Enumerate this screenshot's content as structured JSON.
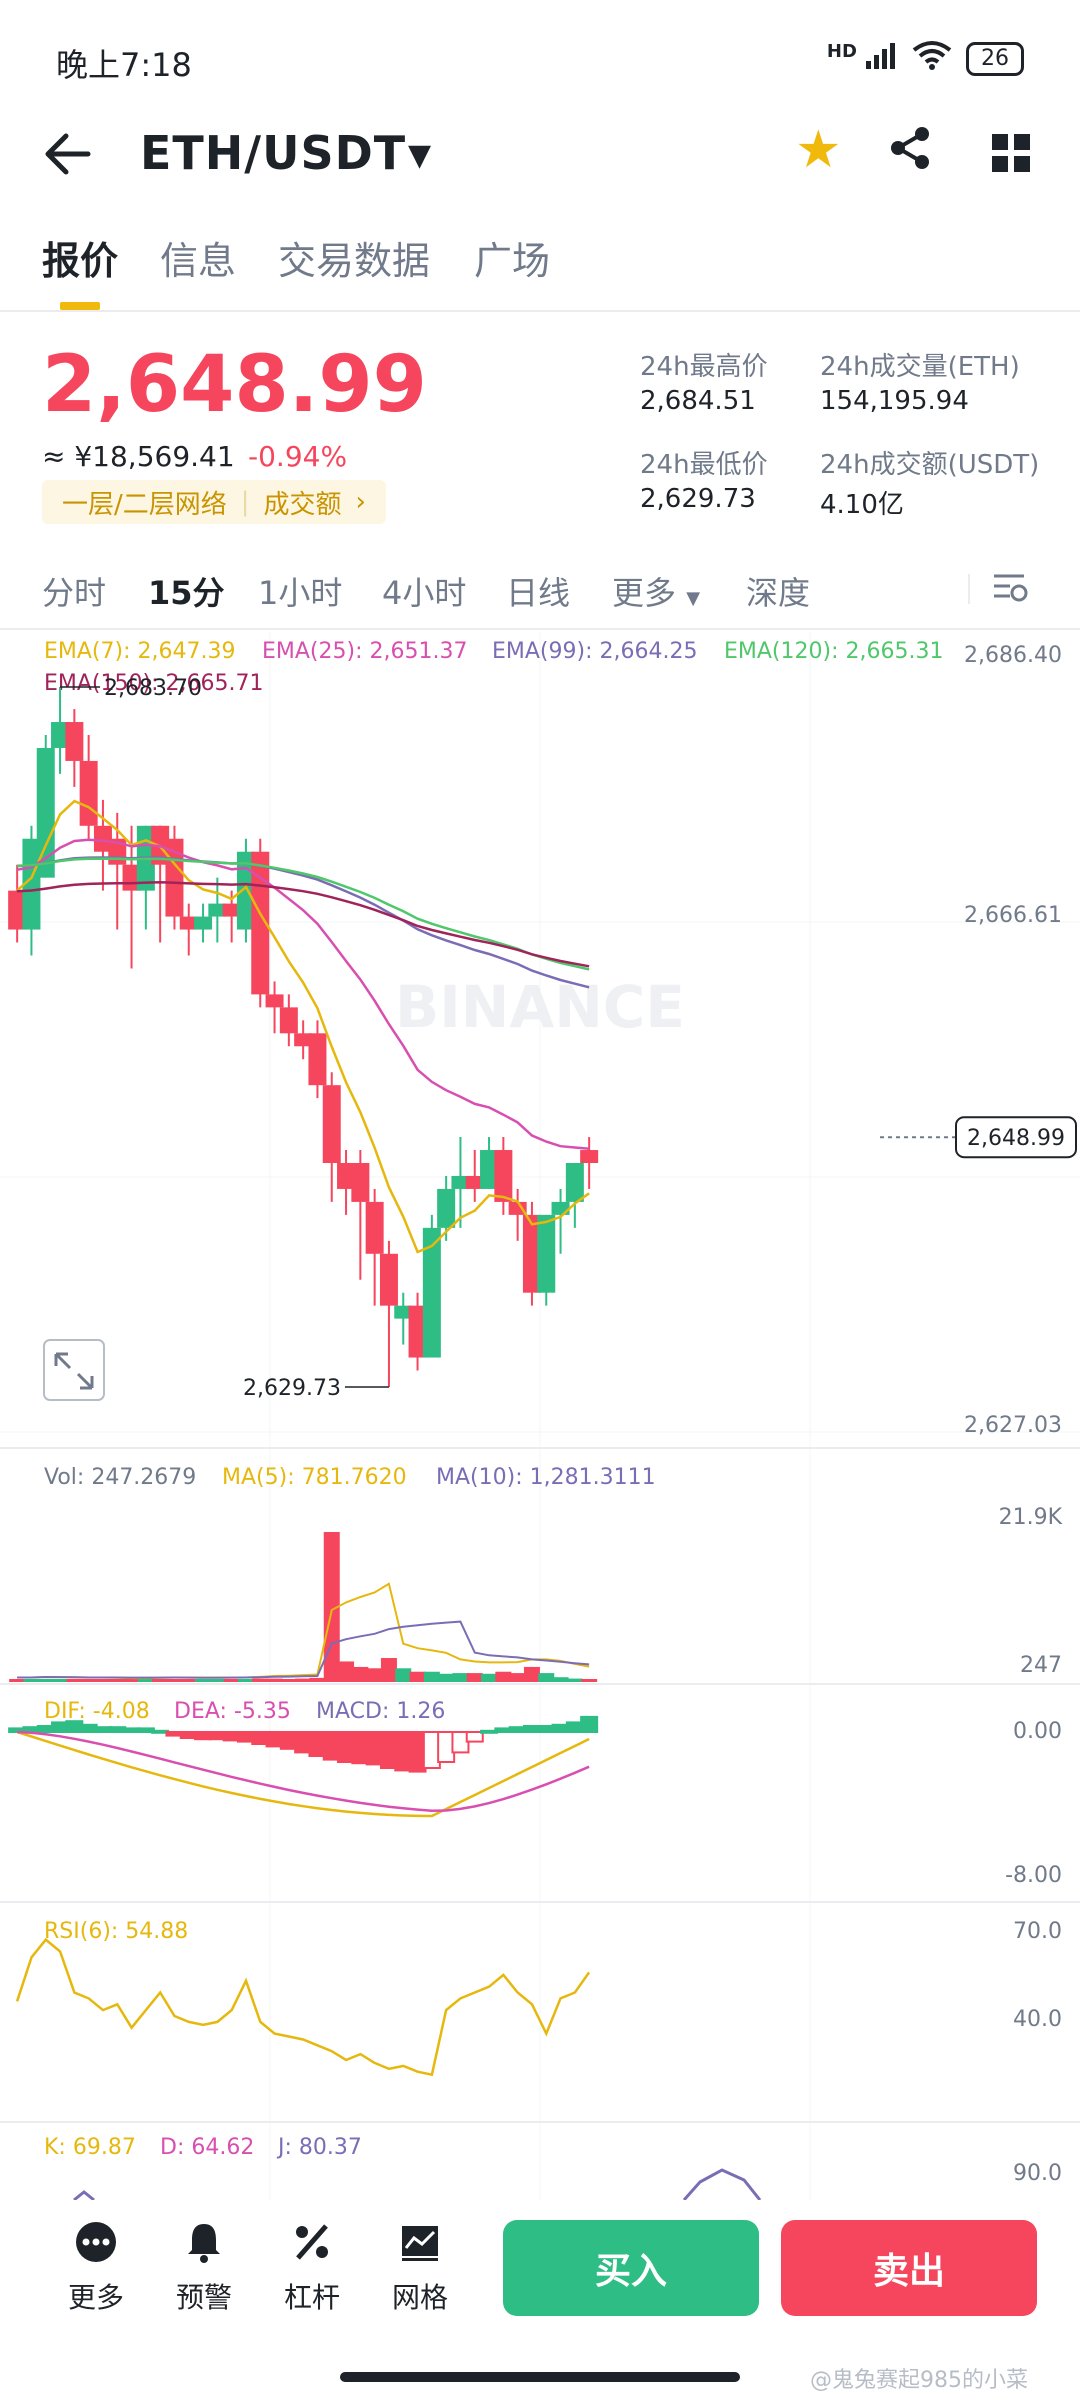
{
  "status_bar": {
    "time": "晚上7:18",
    "signal": "HD",
    "battery": "26"
  },
  "header": {
    "pair": "ETH/USDT"
  },
  "tabs": [
    "报价",
    "信息",
    "交易数据",
    "广场"
  ],
  "quote": {
    "last_price": "2,648.99",
    "cny_price": "≈ ¥18,569.41",
    "change": "-0.94%",
    "network_chip": "一层/二层网络",
    "volume_chip": "成交额",
    "stats": [
      {
        "label": "24h最高价",
        "value": "2,684.51"
      },
      {
        "label": "24h成交量(ETH)",
        "value": "154,195.94"
      },
      {
        "label": "24h最低价",
        "value": "2,629.73"
      },
      {
        "label": "24h成交额(USDT)",
        "value": "4.10亿"
      }
    ]
  },
  "kline_tabs": [
    "分时",
    "15分",
    "1小时",
    "4小时",
    "日线",
    "更多",
    "深度"
  ],
  "kline_active_index": 1,
  "ema_legend": {
    "ema7": "EMA(7): 2,647.39",
    "ema25": "EMA(25): 2,651.37",
    "ema99": "EMA(99): 2,664.25",
    "ema120": "EMA(120): 2,665.31",
    "ema150": "EMA(150): 2,665.71"
  },
  "price_axis": [
    "2,686.40",
    "2,666.61",
    "2,627.03"
  ],
  "current_price_tag": "2,648.99",
  "high_marker": "2,683.70",
  "low_marker": "2,629.73",
  "watermark_text": "BINANCE",
  "volume": {
    "vol": "Vol: 247.2679",
    "ma5": "MA(5): 781.7620",
    "ma10": "MA(10): 1,281.3111",
    "axis_top": "21.9K",
    "axis_bottom": "247"
  },
  "macd": {
    "dif": "DIF: -4.08",
    "dea": "DEA: -5.35",
    "macd": "MACD: 1.26",
    "axis_top": "0.00",
    "axis_bottom": "-8.00"
  },
  "rsi": {
    "label": "RSI(6): 54.88",
    "axis_top": "70.0",
    "axis_bottom": "40.0"
  },
  "kdj": {
    "k": "K: 69.87",
    "d": "D: 64.62",
    "j": "J: 80.37",
    "axis_top": "90.0"
  },
  "bottom_nav": [
    "更多",
    "预警",
    "杠杆",
    "网格"
  ],
  "buy_label": "买入",
  "sell_label": "卖出",
  "watermark_bottom": "@鬼兔赛起985的小菜",
  "colors": {
    "up": "#2ebd85",
    "down": "#f6465d",
    "brand": "#f0b90b",
    "ema7": "#e6b80e",
    "ema25": "#d84fb0",
    "ema99": "#7b6db5",
    "ema120": "#4fc76b",
    "ema150": "#a0235a"
  },
  "chart_data": {
    "type": "candlestick",
    "interval": "15分",
    "ylim": [
      2627.03,
      2686.4
    ],
    "high": 2683.7,
    "low": 2629.73,
    "last": 2648.99,
    "candles": [
      {
        "o": 2668,
        "h": 2670,
        "c": 2665,
        "l": 2664
      },
      {
        "o": 2665,
        "h": 2673,
        "c": 2672,
        "l": 2663
      },
      {
        "o": 2669,
        "h": 2680,
        "c": 2679,
        "l": 2669
      },
      {
        "o": 2679,
        "h": 2683.7,
        "c": 2681,
        "l": 2677
      },
      {
        "o": 2681,
        "h": 2682,
        "c": 2678,
        "l": 2676
      },
      {
        "o": 2678,
        "h": 2680,
        "c": 2673,
        "l": 2672
      },
      {
        "o": 2673,
        "h": 2675,
        "c": 2671,
        "l": 2668
      },
      {
        "o": 2672,
        "h": 2674,
        "c": 2670,
        "l": 2665
      },
      {
        "o": 2670,
        "h": 2673,
        "c": 2668,
        "l": 2662
      },
      {
        "o": 2668,
        "h": 2673,
        "c": 2673,
        "l": 2665
      },
      {
        "o": 2673,
        "h": 2673,
        "c": 2670,
        "l": 2664
      },
      {
        "o": 2672,
        "h": 2673,
        "c": 2666,
        "l": 2665
      },
      {
        "o": 2666,
        "h": 2667,
        "c": 2665,
        "l": 2663
      },
      {
        "o": 2665,
        "h": 2667,
        "c": 2666,
        "l": 2664
      },
      {
        "o": 2666,
        "h": 2669,
        "c": 2667,
        "l": 2664
      },
      {
        "o": 2667,
        "h": 2668,
        "c": 2666,
        "l": 2664
      },
      {
        "o": 2665,
        "h": 2672,
        "c": 2671,
        "l": 2664
      },
      {
        "o": 2671,
        "h": 2672,
        "c": 2660,
        "l": 2659
      },
      {
        "o": 2660,
        "h": 2661,
        "c": 2659,
        "l": 2657
      },
      {
        "o": 2659,
        "h": 2660,
        "c": 2657,
        "l": 2656
      },
      {
        "o": 2657,
        "h": 2658,
        "c": 2656,
        "l": 2655
      },
      {
        "o": 2657,
        "h": 2658,
        "c": 2653,
        "l": 2652
      },
      {
        "o": 2653,
        "h": 2654,
        "c": 2647,
        "l": 2644
      },
      {
        "o": 2647,
        "h": 2648,
        "c": 2645,
        "l": 2643
      },
      {
        "o": 2647,
        "h": 2648,
        "c": 2644,
        "l": 2638
      },
      {
        "o": 2644,
        "h": 2645,
        "c": 2640,
        "l": 2636
      },
      {
        "o": 2640,
        "h": 2641,
        "c": 2636,
        "l": 2629.73
      },
      {
        "o": 2635,
        "h": 2637,
        "c": 2636,
        "l": 2633
      },
      {
        "o": 2636,
        "h": 2637,
        "c": 2632,
        "l": 2631
      },
      {
        "o": 2632,
        "h": 2643,
        "c": 2642,
        "l": 2632
      },
      {
        "o": 2642,
        "h": 2646,
        "c": 2645,
        "l": 2641
      },
      {
        "o": 2645,
        "h": 2649,
        "c": 2646,
        "l": 2642
      },
      {
        "o": 2646,
        "h": 2648,
        "c": 2645,
        "l": 2644
      },
      {
        "o": 2645,
        "h": 2649,
        "c": 2648,
        "l": 2645
      },
      {
        "o": 2648,
        "h": 2649,
        "c": 2644,
        "l": 2643
      },
      {
        "o": 2644,
        "h": 2645,
        "c": 2643,
        "l": 2641
      },
      {
        "o": 2643,
        "h": 2644,
        "c": 2637,
        "l": 2636
      },
      {
        "o": 2637,
        "h": 2643,
        "c": 2643,
        "l": 2636
      },
      {
        "o": 2643,
        "h": 2645,
        "c": 2644,
        "l": 2640
      },
      {
        "o": 2644,
        "h": 2647,
        "c": 2647,
        "l": 2642
      },
      {
        "o": 2648,
        "h": 2649,
        "c": 2647,
        "l": 2645
      }
    ],
    "volume_bars": [
      0.3,
      0.3,
      0.4,
      0.3,
      0.3,
      0.2,
      0.3,
      0.3,
      0.2,
      0.3,
      0.3,
      0.4,
      0.3,
      0.2,
      0.3,
      0.3,
      0.4,
      0.5,
      0.5,
      0.4,
      0.5,
      0.6,
      21.9,
      3.0,
      2.2,
      2.0,
      3.5,
      2.0,
      1.5,
      1.5,
      1.2,
      1.3,
      1.3,
      1.2,
      1.5,
      1.3,
      2.2,
      1.3,
      0.7,
      0.5,
      0.4
    ],
    "macd_hist": [
      0.3,
      0.4,
      0.5,
      0.8,
      0.9,
      0.6,
      0.4,
      0.4,
      0.3,
      0.3,
      0.1,
      -0.3,
      -0.5,
      -0.6,
      -0.6,
      -0.7,
      -0.8,
      -1.0,
      -1.2,
      -1.4,
      -1.7,
      -2.0,
      -2.3,
      -2.5,
      -2.6,
      -2.7,
      -3.0,
      -3.2,
      -3.3,
      -3.0,
      -2.5,
      -1.7,
      -0.8,
      0.1,
      0.3,
      0.4,
      0.5,
      0.5,
      0.6,
      0.8,
      1.26
    ],
    "rsi6": [
      45,
      60,
      66,
      62,
      48,
      46,
      42,
      44,
      36,
      42,
      48,
      40,
      38,
      37,
      38,
      42,
      52,
      38,
      34,
      33,
      32,
      30,
      28,
      25,
      27,
      24,
      22,
      23,
      21,
      20,
      42,
      46,
      48,
      50,
      54,
      48,
      44,
      34,
      46,
      48,
      54.88
    ]
  }
}
